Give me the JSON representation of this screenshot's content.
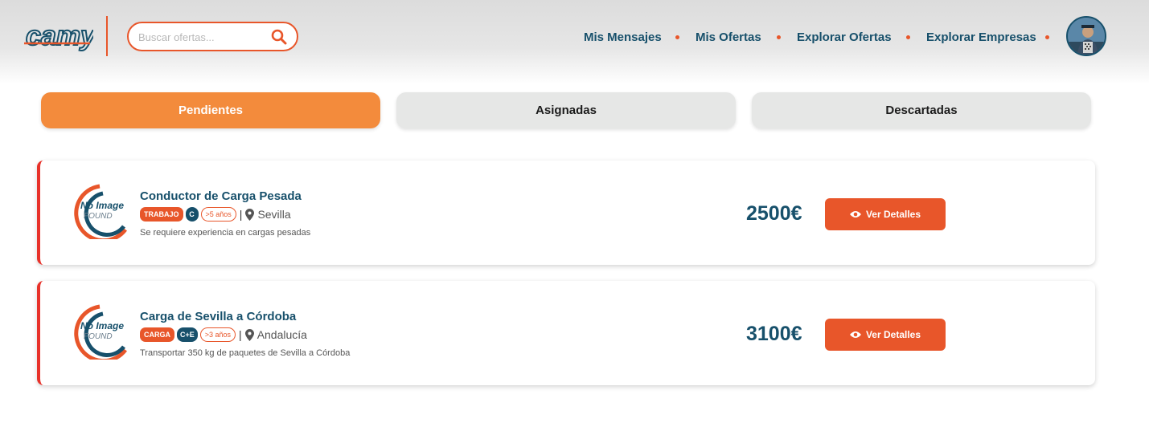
{
  "header": {
    "logo_text": "camyo",
    "search": {
      "placeholder": "Buscar ofertas...",
      "value": ""
    },
    "nav": [
      {
        "label": "Mis Mensajes"
      },
      {
        "label": "Mis Ofertas"
      },
      {
        "label": "Explorar Ofertas"
      },
      {
        "label": "Explorar Empresas"
      }
    ]
  },
  "tabs": [
    {
      "label": "Pendientes",
      "active": true
    },
    {
      "label": "Asignadas",
      "active": false
    },
    {
      "label": "Descartadas",
      "active": false
    }
  ],
  "offers": [
    {
      "title": "Conductor de Carga Pesada",
      "type_badge": "TRABAJO",
      "license_badge": "C",
      "experience_badge": ">5 años",
      "separator": "|",
      "location": "Sevilla",
      "description": "Se requiere experiencia en cargas pesadas",
      "price": "2500€",
      "button_label": "Ver Detalles",
      "image_text_1": "No Image",
      "image_text_2": "FOUND"
    },
    {
      "title": "Carga de Sevilla a Córdoba",
      "type_badge": "CARGA",
      "license_badge": "C+E",
      "experience_badge": ">3 años",
      "separator": "|",
      "location": "Andalucía",
      "description": "Transportar 350 kg de paquetes de Sevilla a Córdoba",
      "price": "3100€",
      "button_label": "Ver Detalles",
      "image_text_1": "No Image",
      "image_text_2": "FOUND"
    }
  ],
  "colors": {
    "primary_dark": "#17506b",
    "accent_orange": "#e8562a",
    "tab_active": "#f38b3c",
    "tab_inactive": "#e6e7e6",
    "card_border": "#e8322a"
  }
}
